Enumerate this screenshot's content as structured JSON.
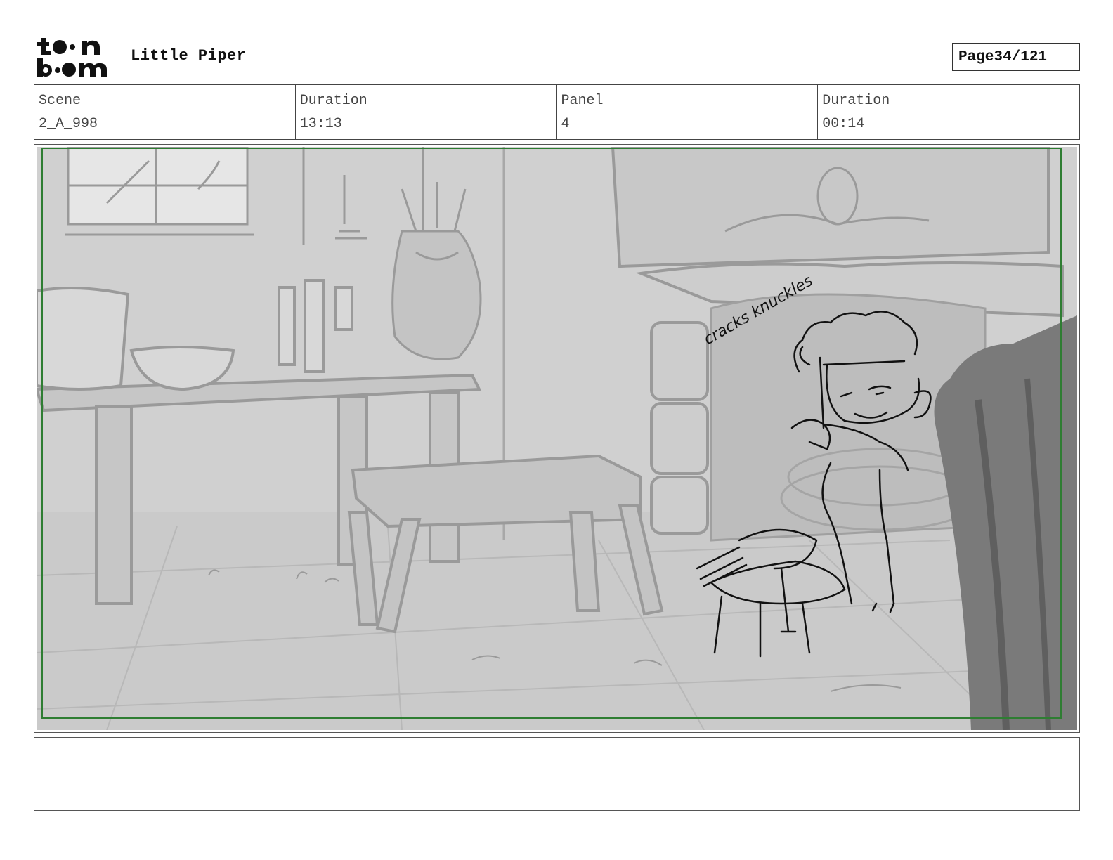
{
  "header": {
    "logo_text": "toon boom",
    "project_title": "Little Piper",
    "page_label": "Page",
    "page_number": "34/121"
  },
  "info": {
    "scene_label": "Scene",
    "scene_value": "2_A_998",
    "scene_duration_label": "Duration",
    "scene_duration_value": "13:13",
    "panel_label": "Panel",
    "panel_value": "4",
    "panel_duration_label": "Duration",
    "panel_duration_value": "00:14"
  },
  "panel": {
    "annotation": "cracks knuckles",
    "safe_frame_color": "#2e7d32"
  },
  "notes": {
    "text": ""
  }
}
